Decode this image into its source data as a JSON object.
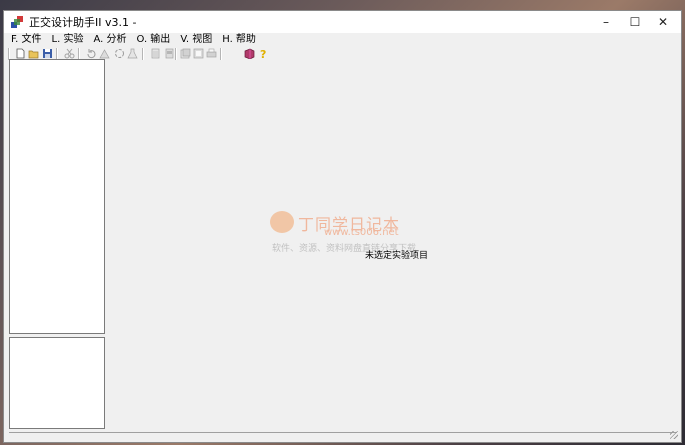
{
  "window": {
    "title": "正交设计助手II v3.1 -",
    "minimize_glyph": "–",
    "maximize_glyph": "☐",
    "close_glyph": "✕"
  },
  "menu": [
    {
      "label": "F. 文件"
    },
    {
      "label": "L. 实验"
    },
    {
      "label": "A. 分析"
    },
    {
      "label": "O. 输出"
    },
    {
      "label": "V. 视图"
    },
    {
      "label": "H. 帮助"
    }
  ],
  "toolbar": {
    "icons": [
      "new-file-icon",
      "open-folder-icon",
      "save-icon",
      "cut-icon",
      "rotate-icon",
      "triangle-icon",
      "recycle-icon",
      "flask-icon",
      "doc1-icon",
      "doc2-icon",
      "doc3-icon",
      "doc4-icon",
      "printer-icon",
      "book-icon",
      "help-icon"
    ],
    "colors": {
      "book": "#b03a6a",
      "help": "#e0b000",
      "folder": "#e8c35a",
      "disk": "#3b5ea8"
    }
  },
  "workspace": {
    "status_text": "未选定实验项目"
  },
  "watermark": {
    "title": "丁同学日记本",
    "url": "www.ts006.net",
    "subtitle": "软件、资源、资料网盘直链分享下载",
    "color": "#f08a5a"
  }
}
